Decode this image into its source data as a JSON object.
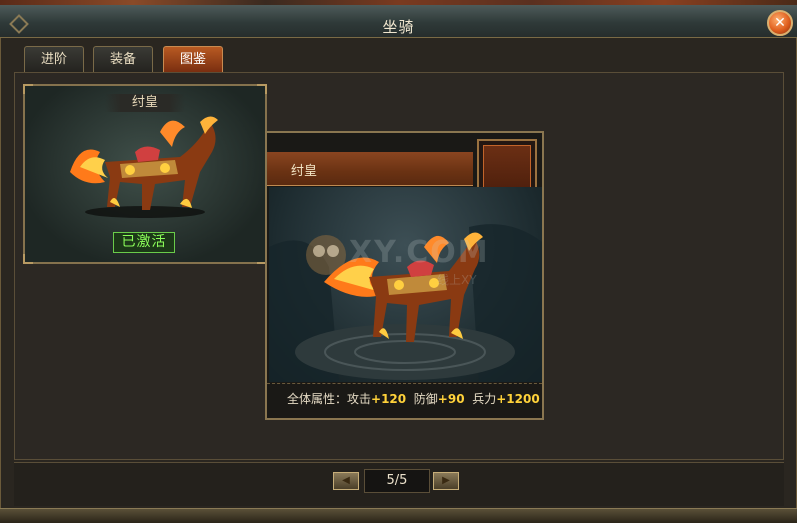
{
  "window": {
    "title": "坐骑",
    "close_icon": "close-icon"
  },
  "tabs": [
    {
      "label": "进阶",
      "active": false
    },
    {
      "label": "装备",
      "active": false
    },
    {
      "label": "图鉴",
      "active": true
    }
  ],
  "gallery": {
    "items": [
      {
        "name": "纣皇",
        "status": "已激活",
        "image": "fire-horse-image"
      }
    ]
  },
  "detail": {
    "name": "纣皇",
    "image": "fire-horse-image",
    "watermark": "XY.COM",
    "watermark_sub": "线上XY",
    "stats": {
      "prefix": "全体属性：",
      "attack_label": "攻击",
      "attack_value": "+120",
      "defense_label": "防御",
      "defense_value": "+90",
      "troops_label": "兵力",
      "troops_value": "+1200"
    }
  },
  "pagination": {
    "current": "5/5",
    "prev_icon": "arrow-left-icon",
    "next_icon": "arrow-right-icon"
  },
  "colors": {
    "accent": "#b85a22",
    "stat_value": "#ffd23a",
    "activated": "#8cff5a"
  }
}
